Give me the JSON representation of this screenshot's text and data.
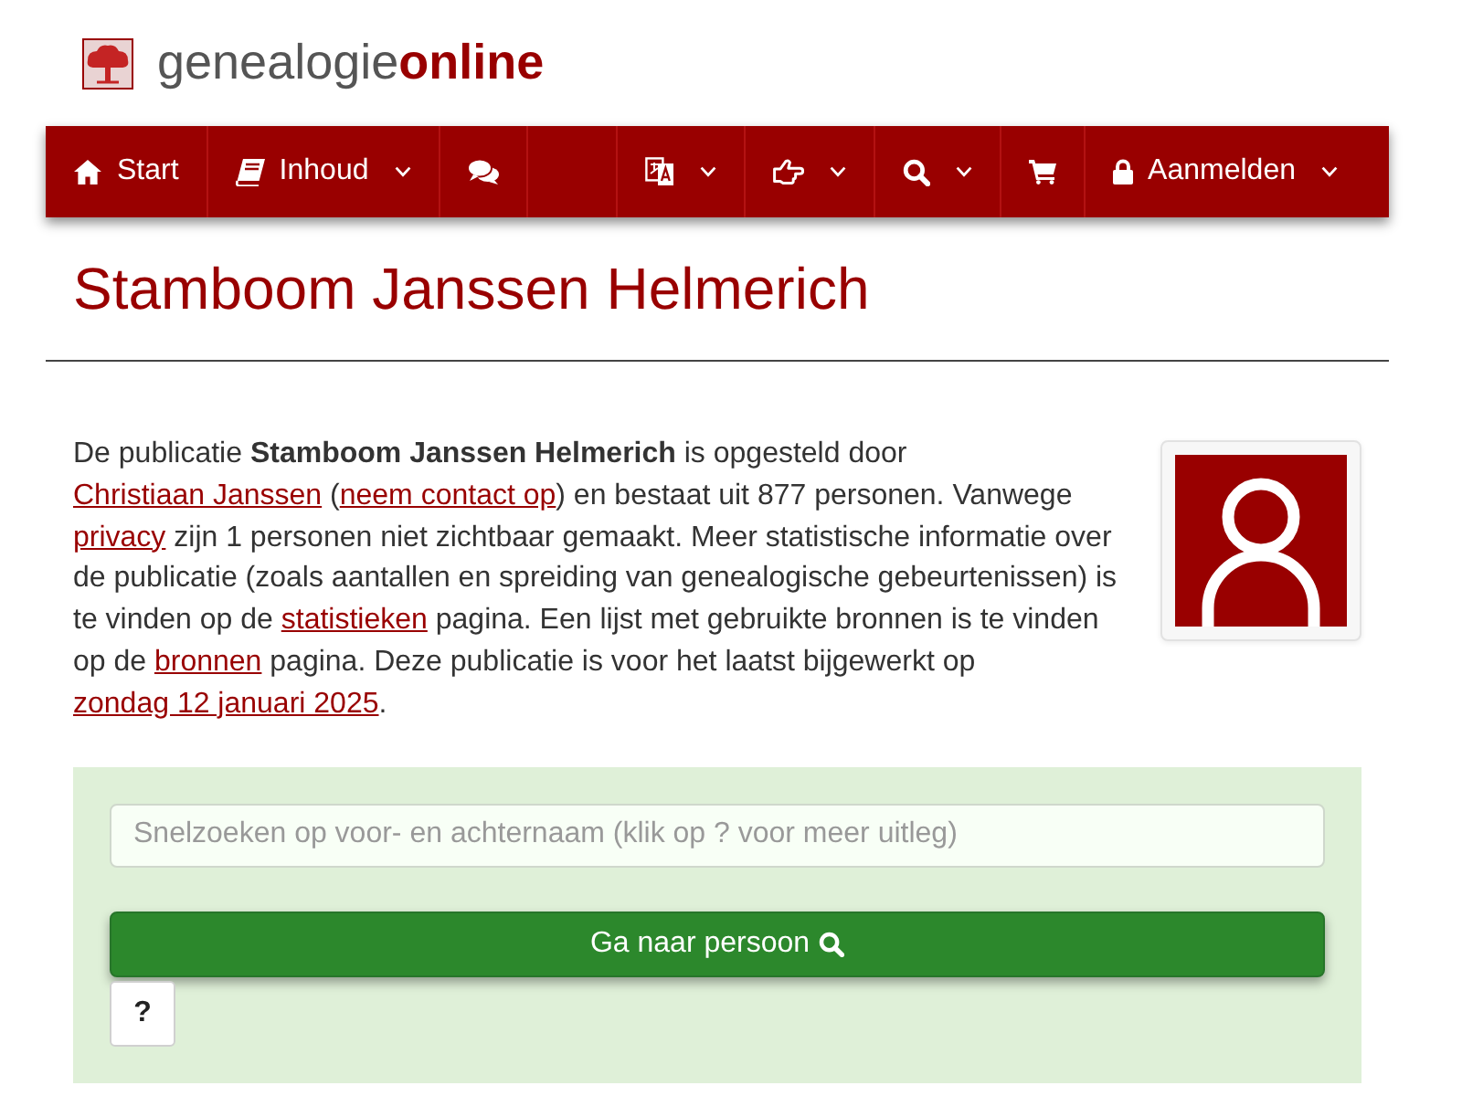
{
  "logo": {
    "text": "genealogie**online**"
  },
  "nav": {
    "left": [
      {
        "label": "Start",
        "dropdown": false
      },
      {
        "label": "Inhoud",
        "dropdown": true
      },
      {
        "dropdown": false
      }
    ],
    "right": [
      {
        "dropdown": true
      },
      {
        "dropdown": true
      },
      {
        "dropdown": true
      },
      {
        "dropdown": false
      },
      {
        "label": "Aanmelden",
        "dropdown": true
      }
    ]
  },
  "title": "Stamboom Janssen Helmerich",
  "intro": [
    {
      "kind": "text",
      "text": "De publicatie **Stamboom Janssen Helmerich** is opgesteld door "
    },
    {
      "kind": "link",
      "text": "Christiaan Janssen"
    },
    {
      "kind": "text",
      "text": " ("
    },
    {
      "kind": "link",
      "text": "neem contact op"
    },
    {
      "kind": "text",
      "text": ") en bestaat uit 877 personen. Vanwege "
    },
    {
      "kind": "link",
      "text": "privacy"
    },
    {
      "kind": "text",
      "text": " zijn 1 personen niet zichtbaar gemaakt. Meer statistische informatie over de publicatie (zoals aantallen en spreiding van genealogische gebeurtenissen) is te vinden op de "
    },
    {
      "kind": "link",
      "text": "statistieken"
    },
    {
      "kind": "text",
      "text": " pagina. Een lijst met gebruikte bronnen is te vinden op de "
    },
    {
      "kind": "link",
      "text": "bronnen"
    },
    {
      "kind": "text",
      "text": " pagina. Deze publicatie is voor het laatst bijgewerkt op "
    },
    {
      "kind": "link",
      "text": "zondag 12 januari 2025"
    },
    {
      "kind": "text",
      "text": "."
    }
  ],
  "search": {
    "placeholder": "Snelzoeken op voor- en achternaam (klik op ? voor meer uitleg)",
    "button": "Ga naar persoon",
    "help": "?"
  }
}
